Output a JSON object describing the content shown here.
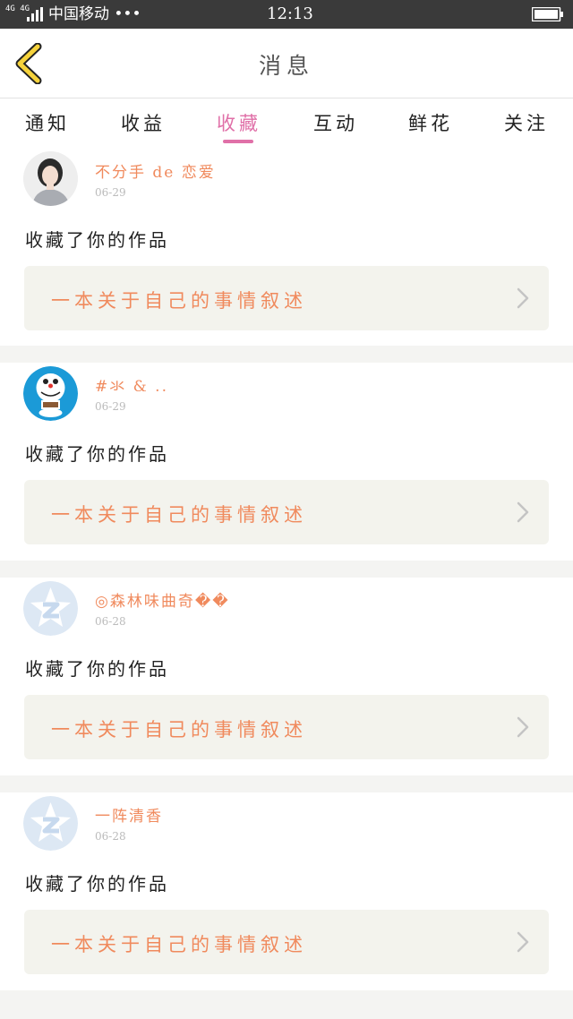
{
  "status_bar": {
    "network": "4G 4G",
    "carrier": "中国移动 •••",
    "time": "12:13",
    "icons": [
      "signal-icon",
      "battery-icon"
    ]
  },
  "header": {
    "title": "消息",
    "back_icon": "chevron-left-icon"
  },
  "tabs": [
    {
      "label": "通知",
      "active": false
    },
    {
      "label": "收益",
      "active": false
    },
    {
      "label": "收藏",
      "active": true
    },
    {
      "label": "互动",
      "active": false
    },
    {
      "label": "鲜花",
      "active": false
    },
    {
      "label": "关注",
      "active": false
    }
  ],
  "items": [
    {
      "username": "不分手 de 恋爱",
      "date": "06-29",
      "avatar": "photo-avatar",
      "action": "收藏了你的作品",
      "work_title": "一本关于自己的事情叙述"
    },
    {
      "username": "#氺 & ..",
      "date": "06-29",
      "avatar": "doraemon-avatar",
      "action": "收藏了你的作品",
      "work_title": "一本关于自己的事情叙述"
    },
    {
      "username": "◎森林味曲奇��",
      "date": "06-28",
      "avatar": "default-qzone-avatar",
      "action": "收藏了你的作品",
      "work_title": "一本关于自己的事情叙述"
    },
    {
      "username": "一阵清香",
      "date": "06-28",
      "avatar": "default-qzone-avatar",
      "action": "收藏了你的作品",
      "work_title": "一本关于自己的事情叙述"
    }
  ],
  "colors": {
    "accent_pink": "#e070a8",
    "username_orange": "#f08a5d",
    "status_bar": "#3a3a3a",
    "card_box": "#f3f3ed"
  }
}
